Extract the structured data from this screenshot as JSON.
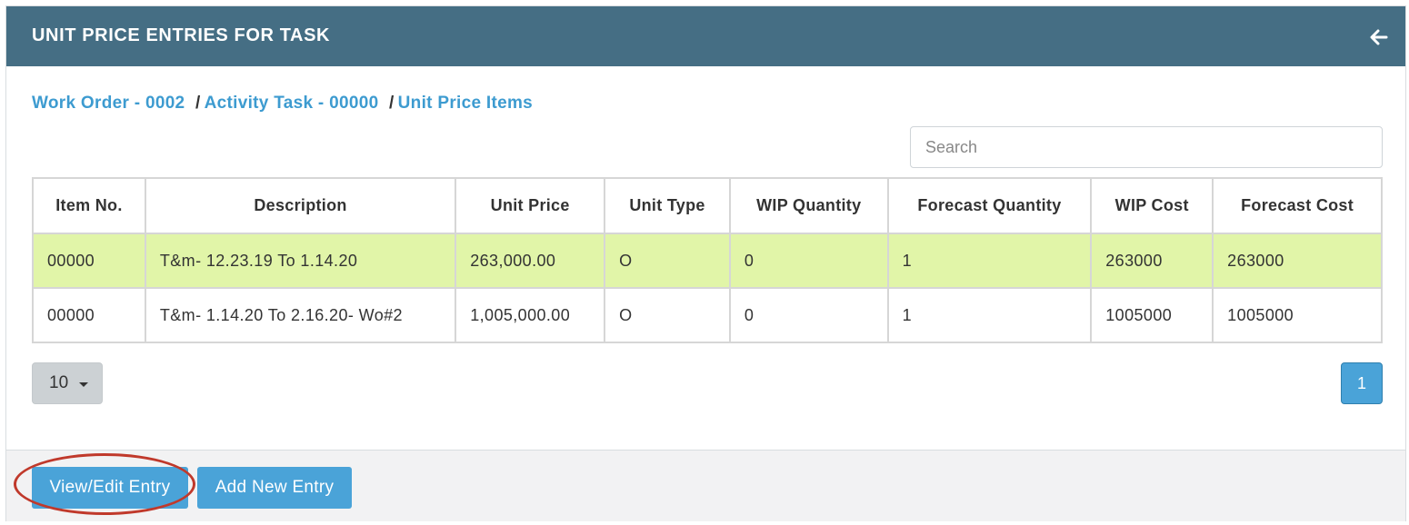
{
  "header": {
    "title": "UNIT PRICE ENTRIES FOR TASK",
    "back_icon": "arrow-left-icon"
  },
  "breadcrumb": {
    "work_order": "Work Order - 0002",
    "separator": "/",
    "activity_task": "Activity Task - 00000",
    "unit_price_items": "Unit Price Items"
  },
  "search": {
    "placeholder": "Search",
    "value": ""
  },
  "table": {
    "columns": [
      "Item No.",
      "Description",
      "Unit Price",
      "Unit Type",
      "WIP Quantity",
      "Forecast Quantity",
      "WIP Cost",
      "Forecast Cost"
    ],
    "rows": [
      [
        "00000",
        "T&m- 12.23.19 To 1.14.20",
        "263,000.00",
        "O",
        "0",
        "1",
        "263000",
        "263000"
      ],
      [
        "00000",
        "T&m- 1.14.20 To 2.16.20- Wo#2",
        "1,005,000.00",
        "O",
        "0",
        "1",
        "1005000",
        "1005000"
      ]
    ],
    "selected_row": 0
  },
  "pagination": {
    "page_size": "10",
    "current_page": "1"
  },
  "footer": {
    "view_edit_label": "View/Edit Entry",
    "add_new_label": "Add New Entry"
  },
  "colors": {
    "header_bg": "#456e84",
    "link": "#3d9bd0",
    "selected_row": "#e1f5a8",
    "button": "#4aa3d8",
    "annotation": "#c0392b"
  }
}
